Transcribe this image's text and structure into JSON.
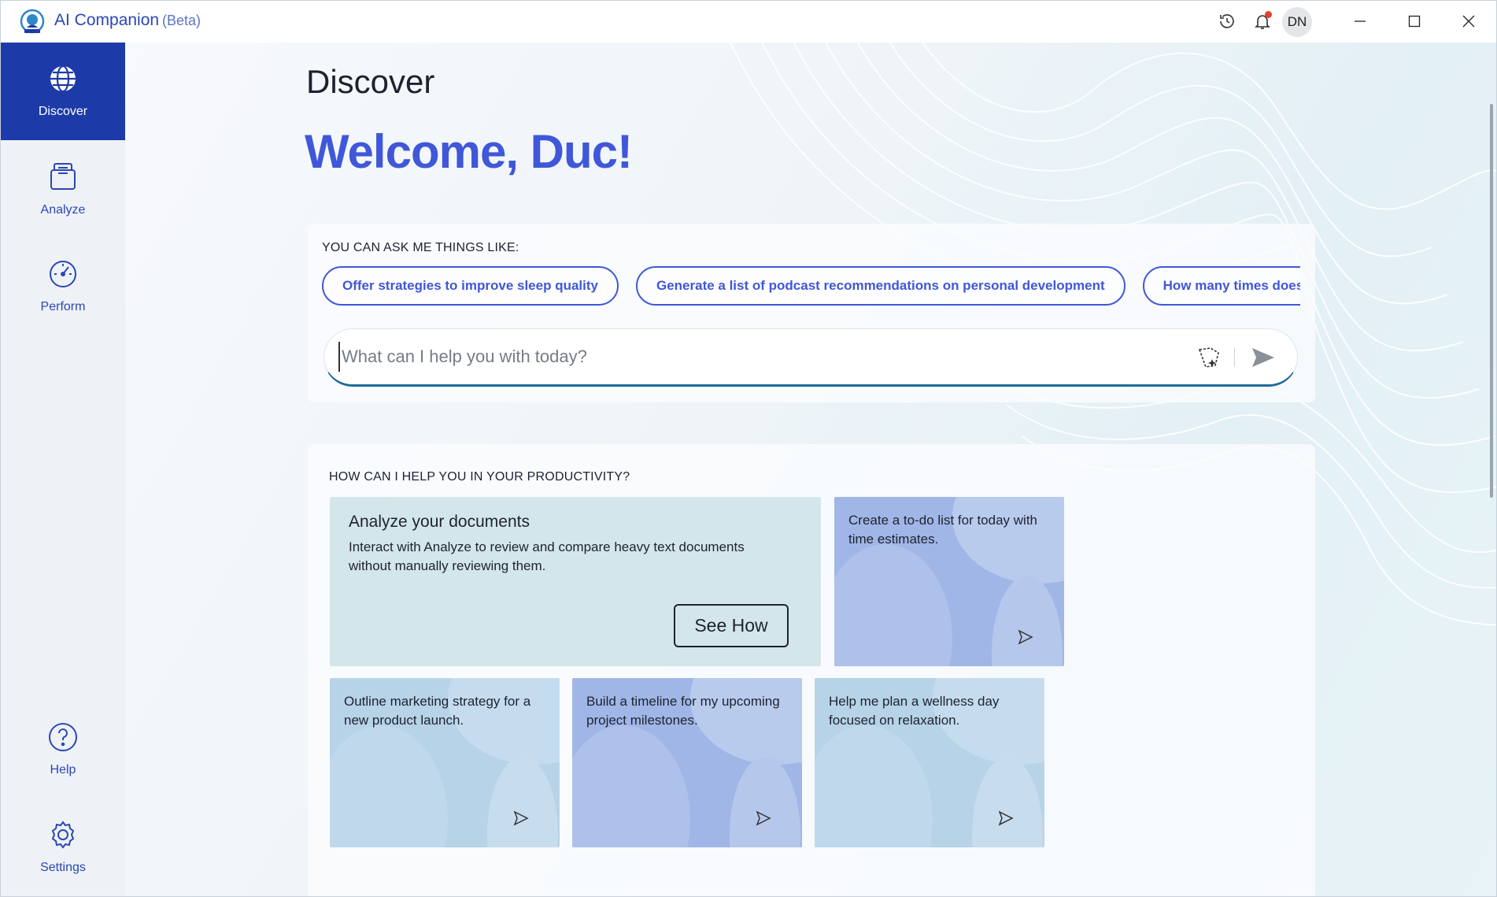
{
  "titlebar": {
    "app_name": "AI Companion",
    "app_tag": "(Beta)",
    "avatar_initials": "DN",
    "icons": [
      "history-icon",
      "bell-icon",
      "minimize-icon",
      "maximize-icon",
      "close-icon"
    ]
  },
  "sidebar": {
    "items": [
      {
        "label": "Discover",
        "icon": "globe-icon",
        "active": true
      },
      {
        "label": "Analyze",
        "icon": "documents-icon",
        "active": false
      },
      {
        "label": "Perform",
        "icon": "gauge-icon",
        "active": false
      },
      {
        "label": "Help",
        "icon": "help-icon",
        "active": false
      },
      {
        "label": "Settings",
        "icon": "gear-icon",
        "active": false
      }
    ]
  },
  "main": {
    "page_title": "Discover",
    "welcome": "Welcome, Duc!",
    "ask": {
      "heading": "YOU CAN ASK ME THINGS LIKE:",
      "chips": [
        "Offer strategies to improve sleep quality",
        "Generate a list of podcast recommendations on personal development",
        "How many times does"
      ],
      "placeholder": "What can I help you with today?",
      "value": ""
    },
    "productivity": {
      "heading": "HOW CAN I HELP YOU IN YOUR PRODUCTIVITY?",
      "feature": {
        "title": "Analyze your documents",
        "description": "Interact with Analyze to review and compare heavy text documents without manually reviewing them.",
        "button": "See How"
      },
      "tiles": [
        "Create a to-do list for today with time estimates.",
        "Outline marketing strategy for a new product launch.",
        "Build a timeline for my upcoming project milestones.",
        "Help me plan a wellness day focused on relaxation."
      ]
    }
  },
  "colors": {
    "accent": "#3f57d8",
    "sidebar_active": "#1d3ba8",
    "feature_tile": "#d3e6ec",
    "tile_light": "#b7d3e8",
    "tile_purple": "#a0b6e6"
  }
}
